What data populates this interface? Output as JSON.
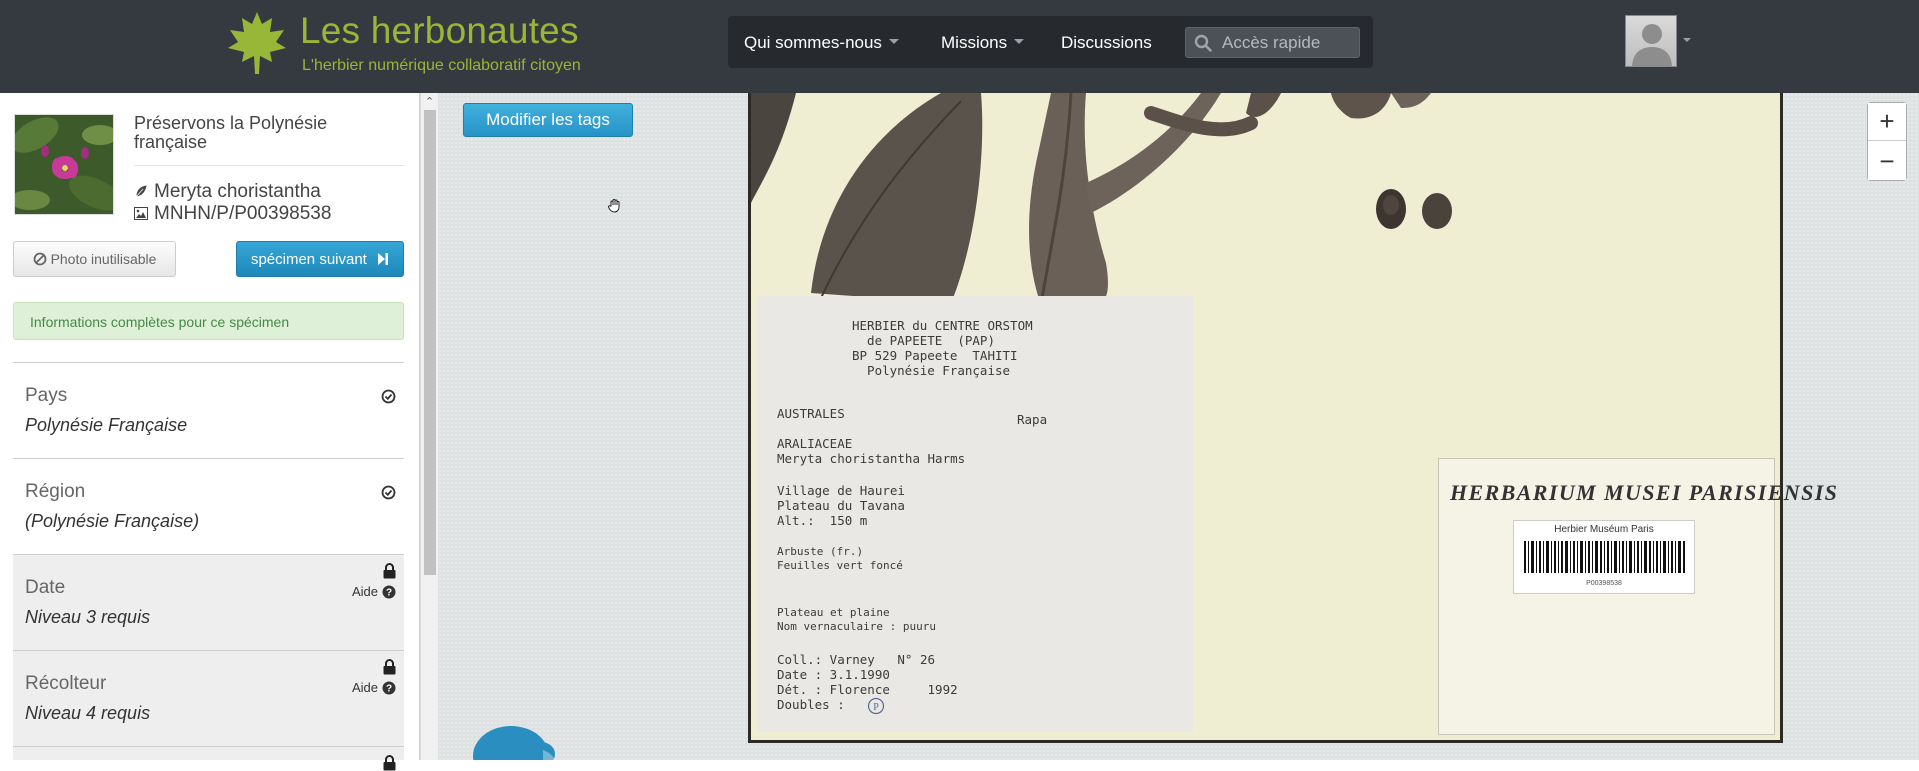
{
  "brand": {
    "title": "Les herbonautes",
    "subtitle": "L'herbier numérique collaboratif citoyen",
    "logo_color": "#98b637"
  },
  "nav": {
    "items": [
      {
        "label": "Qui sommes-nous",
        "dropdown": true
      },
      {
        "label": "Missions",
        "dropdown": true
      },
      {
        "label": "Discussions",
        "dropdown": false
      }
    ],
    "search_placeholder": "Accès rapide"
  },
  "mission": {
    "title": "Préservons la Polynésie française",
    "species": "Meryta choristantha",
    "specimen_code": "MNHN/P/P00398538"
  },
  "actions": {
    "photo_unusable": "Photo inutilisable",
    "next_specimen": "spécimen suivant",
    "modify_tags": "Modifier les tags"
  },
  "alert": {
    "text": "Informations complètes pour ce spécimen",
    "color": "#dff0d8"
  },
  "fields": [
    {
      "label": "Pays",
      "value": "Polynésie Française",
      "status": "completed"
    },
    {
      "label": "Région",
      "value": "(Polynésie Française)",
      "status": "completed"
    },
    {
      "label": "Date",
      "value": "Niveau 3 requis",
      "status": "locked",
      "help": "Aide"
    },
    {
      "label": "Récolteur",
      "value": "Niveau 4 requis",
      "status": "locked",
      "help": "Aide"
    }
  ],
  "zoom": {
    "in": "+",
    "out": "−"
  },
  "specimen_label": {
    "header": "HERBIER du CENTRE ORSTOM\n  de PAPEETE  (PAP)\nBP 529 Papeete  TAHITI\n  Polynésie Française",
    "region_left": "AUSTRALES",
    "region_right": "Rapa",
    "family": "ARALIACEAE\nMeryta choristantha Harms",
    "locality": "Village de Haurei\nPlateau du Tavana\nAlt.:  150 m",
    "habit": "Arbuste (fr.)\nFeuilles vert foncé",
    "notes": "Plateau et plaine\nNom vernaculaire : puuru",
    "collection": "Coll.: Varney   N° 26\nDate : 3.1.1990\nDét. : Florence     1992\nDoubles :"
  },
  "herbarium": {
    "title": "HERBARIUM MUSEI PARISIENSIS",
    "barcode_title": "Herbier Muséum Paris",
    "barcode_number": "P00398538"
  }
}
